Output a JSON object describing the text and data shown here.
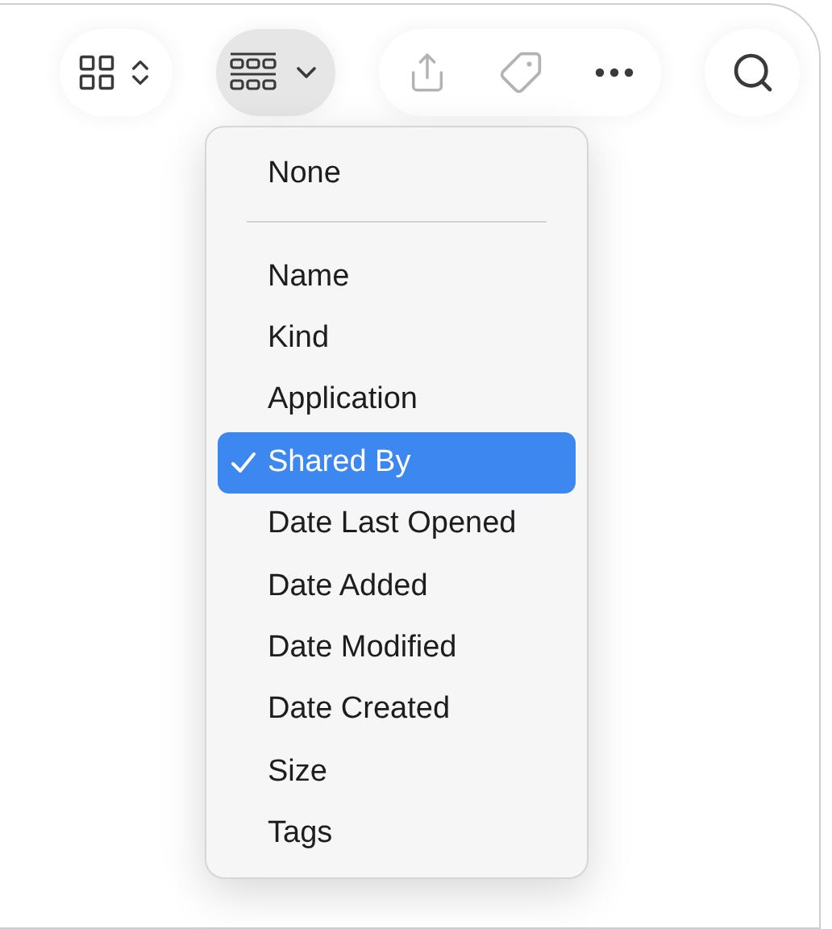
{
  "toolbar": {
    "view_button": {
      "pressed": false
    },
    "group_button": {
      "pressed": true
    },
    "actions": [
      {
        "kind": "share",
        "disabled": true
      },
      {
        "kind": "tag",
        "disabled": true
      },
      {
        "kind": "more",
        "disabled": false
      }
    ],
    "search_button": {
      "pressed": false
    }
  },
  "group_menu": {
    "items": [
      {
        "kind": "item",
        "label": "None",
        "checked": false,
        "selected": false
      },
      {
        "kind": "separator"
      },
      {
        "kind": "item",
        "label": "Name",
        "checked": false,
        "selected": false
      },
      {
        "kind": "item",
        "label": "Kind",
        "checked": false,
        "selected": false
      },
      {
        "kind": "item",
        "label": "Application",
        "checked": false,
        "selected": false
      },
      {
        "kind": "item",
        "label": "Shared By",
        "checked": true,
        "selected": true
      },
      {
        "kind": "item",
        "label": "Date Last Opened",
        "checked": false,
        "selected": false
      },
      {
        "kind": "item",
        "label": "Date Added",
        "checked": false,
        "selected": false
      },
      {
        "kind": "item",
        "label": "Date Modified",
        "checked": false,
        "selected": false
      },
      {
        "kind": "item",
        "label": "Date Created",
        "checked": false,
        "selected": false
      },
      {
        "kind": "item",
        "label": "Size",
        "checked": false,
        "selected": false
      },
      {
        "kind": "item",
        "label": "Tags",
        "checked": false,
        "selected": false
      }
    ]
  }
}
